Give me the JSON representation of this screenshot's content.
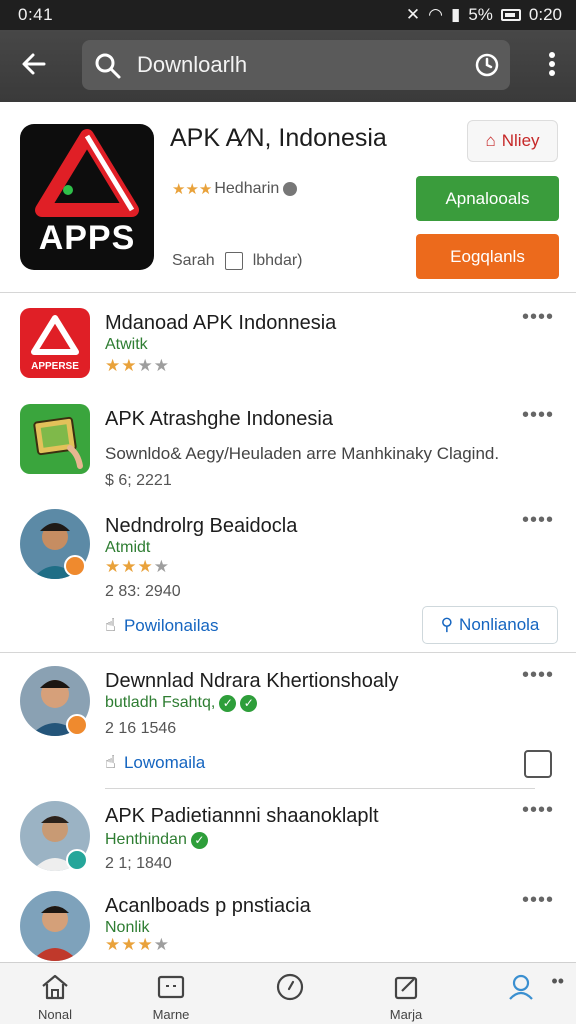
{
  "status_bar": {
    "time": "0:41",
    "signal_text": "5%",
    "clock_right": "0:20"
  },
  "search": {
    "query": "Downloarlh"
  },
  "header_app": {
    "logo_text": "APPS",
    "title": "APK A⁄N, Indonesia",
    "rating_text": "Hedharin",
    "meta_left": "Sarah",
    "meta_right": "lbhdar)",
    "tag_button": "Nliey",
    "primary_button": "Apnalooals",
    "secondary_button": "Eogqlanls"
  },
  "items": [
    {
      "title": "Mdanoad APK Indonnesia",
      "sub": "Atwitk",
      "logo_text": "APPERSE",
      "stars": 2
    },
    {
      "title": "APK Atrashghe Indonesia",
      "desc": "Sownldo& Aegy/Heuladen arre Manhkinaky Clagind.",
      "meta": "$ 6; 2221"
    },
    {
      "title": "Nedndrolrg Beaidocla",
      "sub": "Atmidt",
      "stars": 3,
      "meta": "2 83: 2940",
      "link": "Powilonailas",
      "button": "Nonlianola"
    },
    {
      "title": "Dewnnlad Ndrara Khertionshoaly",
      "sub": "butladh Fsahtq,",
      "meta": "2 16 1546",
      "link": "Lowomaila"
    },
    {
      "title": "APK Padietiannni shaanoklaplt",
      "sub": "Henthindan",
      "meta": "2 1; 1840"
    },
    {
      "title": "Acanlboads p pnstiacia",
      "sub": "Nonlik",
      "stars": 3
    }
  ],
  "bottom_nav": [
    "Nonal",
    "Marne",
    "",
    "Marja",
    ""
  ],
  "colors": {
    "green": "#3a9c3c",
    "orange": "#ec6a1c",
    "link": "#1565c0",
    "star": "#e9a23b"
  }
}
